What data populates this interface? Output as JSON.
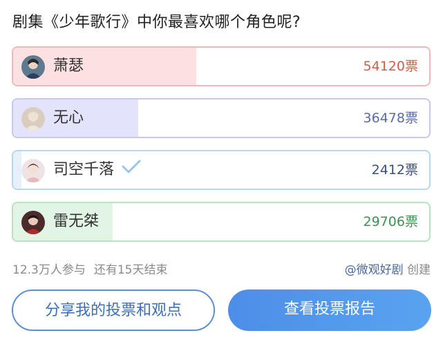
{
  "poll": {
    "question": "剧集《少年歌行》中你最喜欢哪个角色呢?",
    "options": [
      {
        "name": "萧瑟",
        "votes": "54120票",
        "fraction": 0.44,
        "border": "#f3b7b7",
        "fill": "#fbe1e1",
        "vote_color": "#d65c4a",
        "selected": false
      },
      {
        "name": "无心",
        "votes": "36478票",
        "fraction": 0.3,
        "border": "#c5c8f1",
        "fill": "#e3e4fb",
        "vote_color": "#5a6aa8",
        "selected": false
      },
      {
        "name": "司空千落",
        "votes": "2412票",
        "fraction": 0.02,
        "border": "#b9d6ee",
        "fill": "#e4f0fb",
        "vote_color": "#3a4f7a",
        "selected": true
      },
      {
        "name": "雷无桀",
        "votes": "29706票",
        "fraction": 0.24,
        "border": "#b8e2c0",
        "fill": "#e2f5e5",
        "vote_color": "#3d9450",
        "selected": false
      }
    ]
  },
  "footer": {
    "participants": "12.3万人参与",
    "remaining": "还有15天结束",
    "author": "@微观好剧",
    "created": "创建"
  },
  "buttons": {
    "share": "分享我的投票和观点",
    "report": "查看投票报告"
  }
}
